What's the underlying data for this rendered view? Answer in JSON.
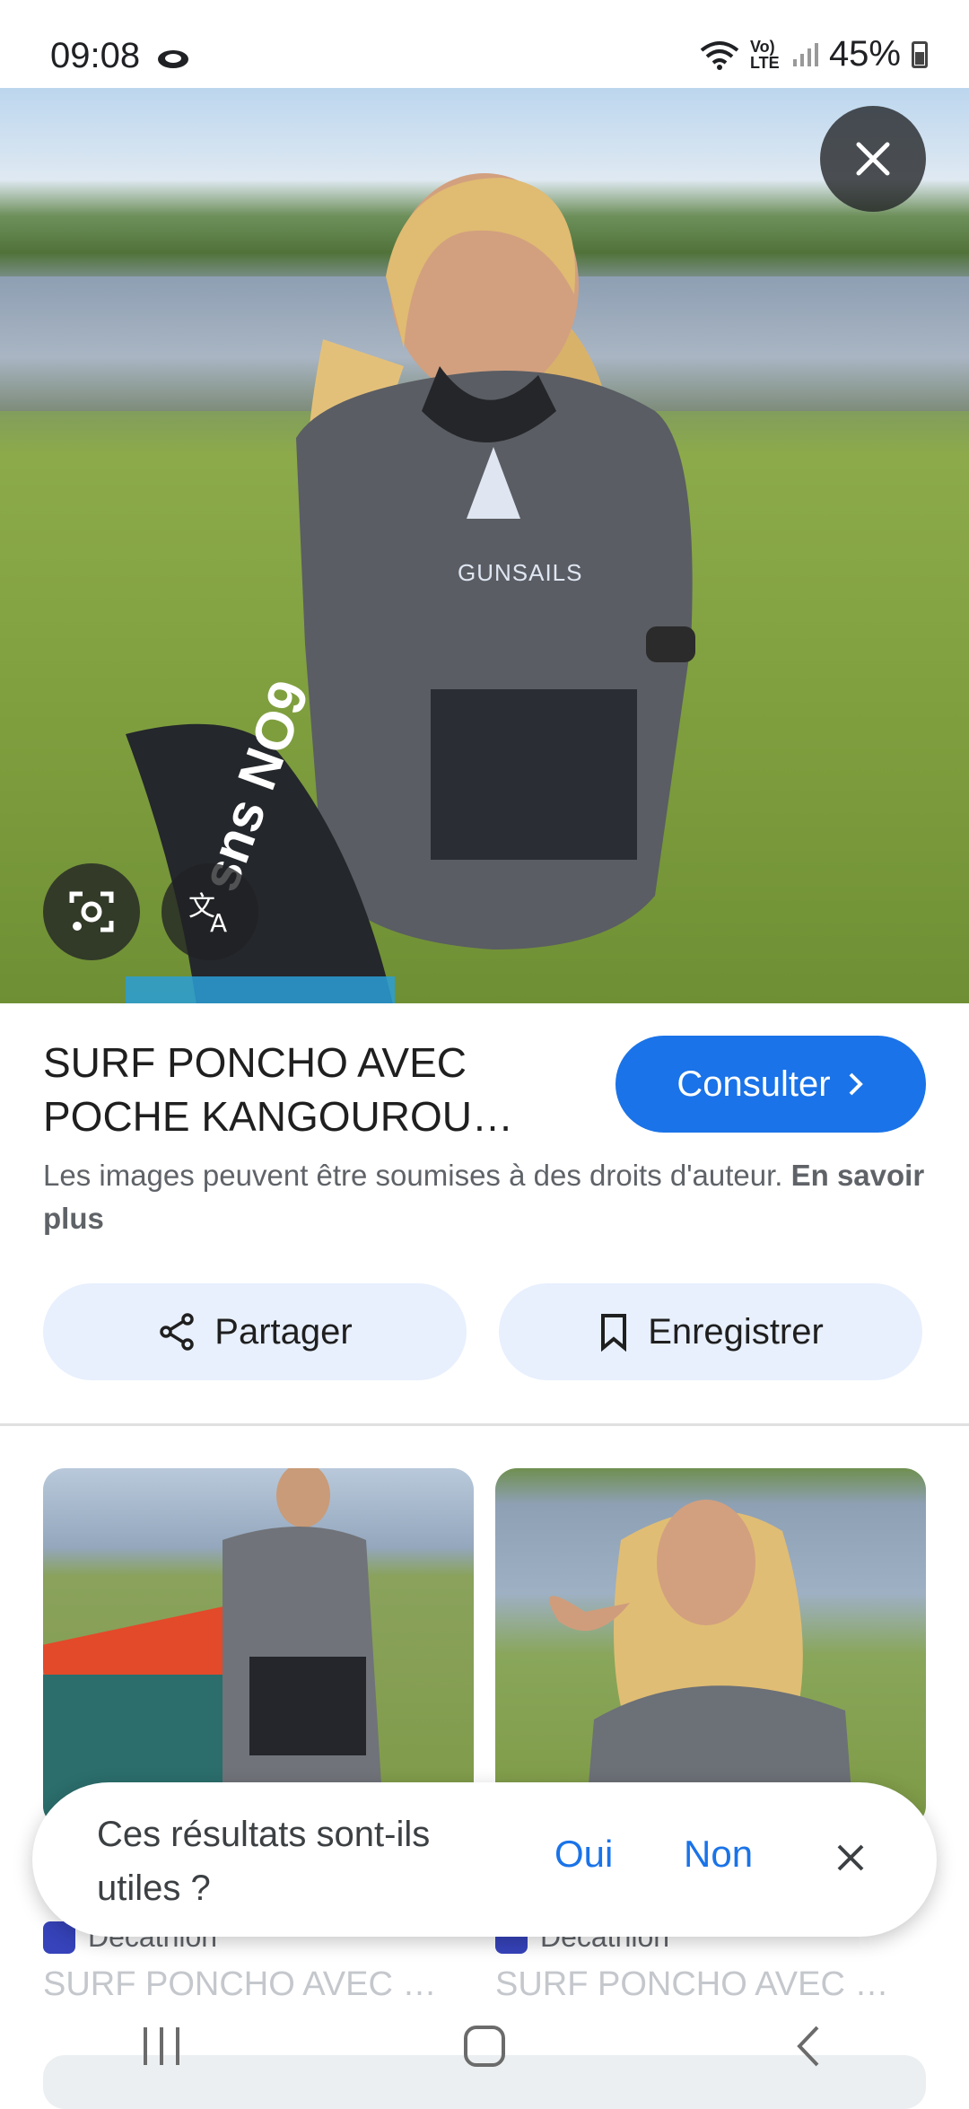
{
  "status": {
    "time": "09:08",
    "battery": "45%",
    "network": "Vo) LTE"
  },
  "hero": {
    "logo_text": "GUNSAILS",
    "fin_text": "sns NO9"
  },
  "product": {
    "title": "SURF PONCHO AVEC POCHE KANGOUROU…",
    "consult_label": "Consulter",
    "copyright_text": "Les images peuvent être soumises à des droits d'auteur.",
    "learn_more": "En savoir plus"
  },
  "actions": {
    "share_label": "Partager",
    "save_label": "Enregistrer"
  },
  "related": [
    {
      "source": "Decathlon",
      "title": "SURF PONCHO AVEC …"
    },
    {
      "source": "Decathlon",
      "title": "SURF PONCHO AVEC …"
    }
  ],
  "feedback": {
    "question": "Ces résultats sont-ils utiles ?",
    "yes": "Oui",
    "no": "Non"
  },
  "colors": {
    "accent": "#1a73e8",
    "pill": "#e8f0fe",
    "decathlon": "#3643ba"
  }
}
